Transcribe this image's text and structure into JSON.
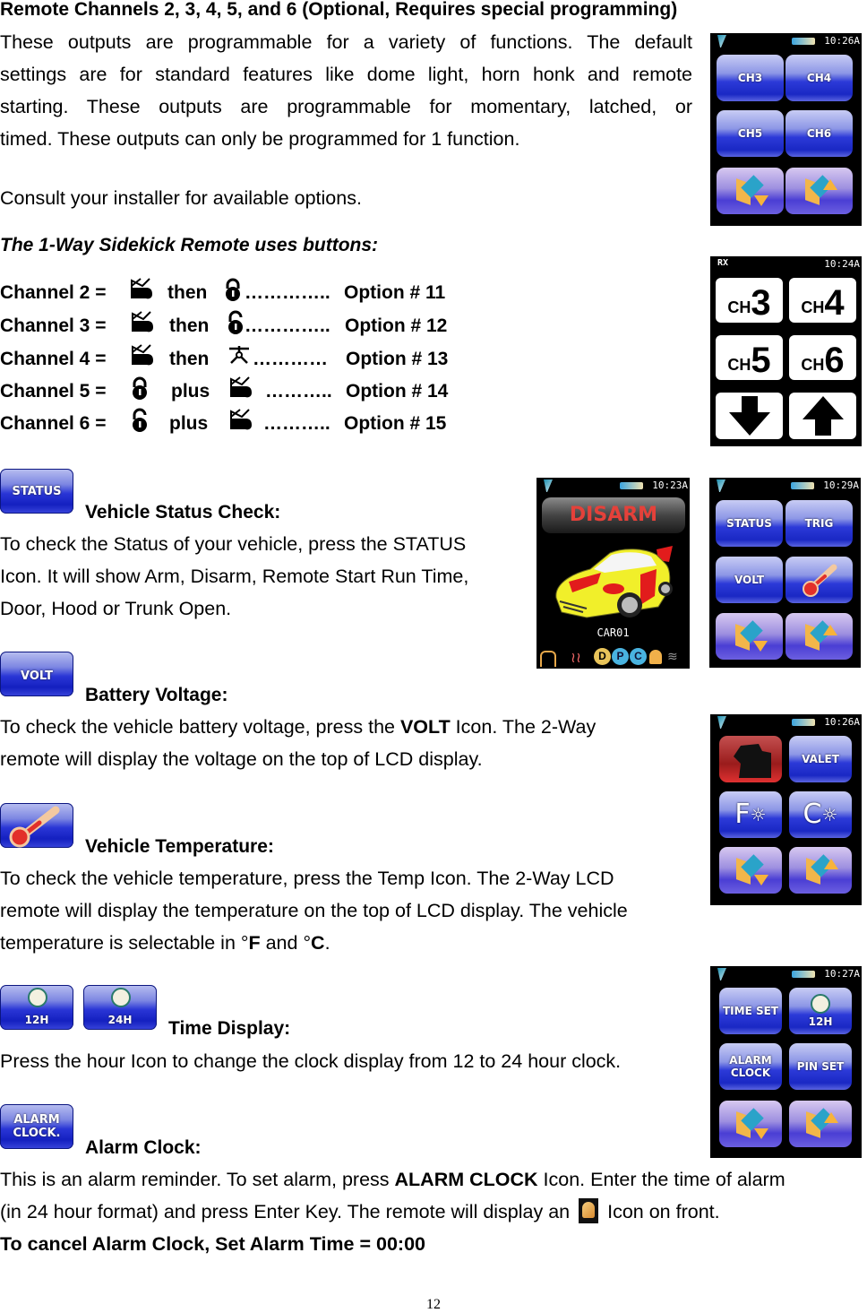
{
  "section_title": "Remote Channels 2, 3, 4, 5, and 6 (Optional, Requires special programming)",
  "intro_lines": [
    "These outputs are programmable for a variety of functions. The default",
    "settings are for standard features like dome light, horn honk and remote",
    "starting. These outputs are programmable for momentary, latched, or",
    "timed. These outputs can only be programmed for 1 function."
  ],
  "consult": "Consult your installer for available options.",
  "sidekick_heading": "The 1-Way Sidekick Remote uses buttons:",
  "channels": [
    {
      "label": "Channel 2 =",
      "icon1": "trunk-icon",
      "joiner": "then",
      "icon2": "lock-icon",
      "dots": "…………..",
      "option": "Option # 11"
    },
    {
      "label": "Channel 3 =",
      "icon1": "trunk-icon",
      "joiner": "then",
      "icon2": "unlock-icon",
      "dots": "…………..",
      "option": "Option # 12"
    },
    {
      "label": "Channel 4 =",
      "icon1": "trunk-icon",
      "joiner": "then",
      "icon2": "star-icon",
      "dots": "…………",
      "option": "Option # 13"
    },
    {
      "label": "Channel 5 =",
      "icon1": "lock-icon",
      "joiner": "plus",
      "icon2": "trunk-icon",
      "dots": "………..",
      "option": "Option # 14"
    },
    {
      "label": "Channel 6 =",
      "icon1": "unlock-icon",
      "joiner": "plus",
      "icon2": "trunk-icon",
      "dots": "………..",
      "option": "Option # 15"
    }
  ],
  "status": {
    "icon_label": "STATUS",
    "heading": "Vehicle Status Check:",
    "lines": [
      "To check the Status of your vehicle, press the STATUS",
      "Icon. It will show Arm, Disarm, Remote Start Run Time,",
      "Door, Hood or Trunk Open."
    ]
  },
  "volt": {
    "icon_label": "VOLT",
    "heading": "Battery Voltage:",
    "line1_pre": "To check the vehicle battery voltage, press the ",
    "line1_bold": "VOLT",
    "line1_post": " Icon. The 2-Way",
    "line2": "remote will display the voltage on the top of LCD display."
  },
  "temp": {
    "heading": "Vehicle Temperature:",
    "lines": [
      "To check the vehicle temperature, press the Temp Icon. The 2-Way LCD",
      "remote will display the temperature on the top of LCD display. The vehicle"
    ],
    "line3_pre": "temperature is selectable in °",
    "line3_f": "F",
    "line3_mid": " and °",
    "line3_c": "C",
    "line3_post": "."
  },
  "time": {
    "icon_12": "12H",
    "icon_24": "24H",
    "heading": "Time Display:",
    "line": "Press the hour Icon to change the clock display from 12 to 24 hour clock."
  },
  "alarm": {
    "icon_label_1": "ALARM",
    "icon_label_2": "CLOCK.",
    "heading": "Alarm Clock:",
    "line1_pre": "This is an alarm reminder. To set alarm, press ",
    "line1_bold": "ALARM CLOCK",
    "line1_post": " Icon. Enter the time of alarm",
    "line2_pre": "(in 24 hour format) and press Enter Key. The remote will display an ",
    "line2_post": " Icon on front.",
    "cancel": "To cancel Alarm Clock, Set Alarm Time = 00:00"
  },
  "screens": {
    "channels_2way": {
      "time": "10:26A",
      "buttons": [
        "CH3",
        "CH4",
        "CH5",
        "CH6"
      ]
    },
    "channels_1way": {
      "status": "RX",
      "time": "10:24A",
      "buttons": [
        {
          "ch": "CH",
          "num": "3"
        },
        {
          "ch": "CH",
          "num": "4"
        },
        {
          "ch": "CH",
          "num": "5"
        },
        {
          "ch": "CH",
          "num": "6"
        }
      ]
    },
    "disarm": {
      "time": "10:23A",
      "banner": "DISARM",
      "car_name": "CAR01",
      "indicators": [
        "D",
        "P",
        "C"
      ]
    },
    "status_menu": {
      "time": "10:29A",
      "buttons": [
        "STATUS",
        "TRIG",
        "VOLT",
        "thermometer"
      ]
    },
    "valet_menu": {
      "time": "10:26A",
      "buttons": [
        "VALET",
        "F",
        "C"
      ]
    },
    "time_menu": {
      "time": "10:27A",
      "buttons": [
        "TIME SET",
        "12H",
        "ALARM CLOCK",
        "PIN SET"
      ]
    }
  },
  "page_number": "12"
}
